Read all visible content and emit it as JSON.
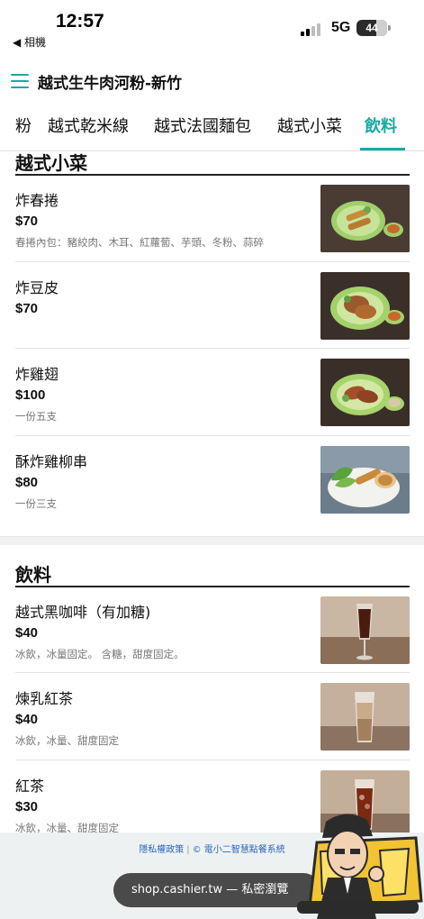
{
  "status_bar": {
    "time": "12:57",
    "back_app": "◀ 相機",
    "network": "5G",
    "battery": "44"
  },
  "header": {
    "title": "越式生牛肉河粉-新竹"
  },
  "tabs": [
    {
      "label": "粉"
    },
    {
      "label": "越式乾米線"
    },
    {
      "label": "越式法國麵包"
    },
    {
      "label": "越式小菜"
    },
    {
      "label": "飲料",
      "active": true
    }
  ],
  "sections": [
    {
      "title": "越式小菜",
      "items": [
        {
          "name": "炸春捲",
          "price": "$70",
          "desc": "春捲內包：豬絞肉、木耳、紅蘿蔔、芋頭、冬粉、蒜碎"
        },
        {
          "name": "炸豆皮",
          "price": "$70",
          "desc": ""
        },
        {
          "name": "炸雞翅",
          "price": "$100",
          "desc": "一份五支"
        },
        {
          "name": "酥炸雞柳串",
          "price": "$80",
          "desc": "一份三支"
        }
      ]
    },
    {
      "title": "飲料",
      "items": [
        {
          "name": "越式黑咖啡（有加糖)",
          "price": "$40",
          "desc": "冰飲，冰量固定。 含糖，甜度固定。"
        },
        {
          "name": "煉乳紅茶",
          "price": "$40",
          "desc": "冰飲，冰量、甜度固定"
        },
        {
          "name": "紅茶",
          "price": "$30",
          "desc": "冰飲，冰量、甜度固定"
        }
      ]
    }
  ],
  "footer": {
    "privacy_link": "隱私權政策",
    "powered_by": "© 電小二智慧點餐系統",
    "url_bar": "shop.cashier.tw — 私密瀏覽"
  },
  "colors": {
    "accent": "#19a9a3",
    "link": "#2a67b8"
  }
}
